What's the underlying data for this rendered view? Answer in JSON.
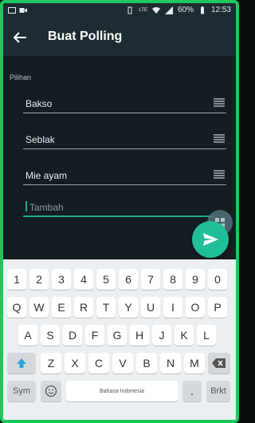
{
  "status": {
    "battery": "60%",
    "time": "12:53",
    "network": "LTE"
  },
  "appbar": {
    "title": "Buat Polling"
  },
  "section": {
    "label": "Pilihan"
  },
  "options": [
    {
      "label": "Bakso"
    },
    {
      "label": "Seblak"
    },
    {
      "label": "Mie ayam"
    }
  ],
  "add_field": {
    "placeholder": "Tambah"
  },
  "keyboard": {
    "numbers": [
      "1",
      "2",
      "3",
      "4",
      "5",
      "6",
      "7",
      "8",
      "9",
      "0"
    ],
    "row1": [
      "Q",
      "W",
      "E",
      "R",
      "T",
      "Y",
      "U",
      "I",
      "O",
      "P"
    ],
    "row2": [
      "A",
      "S",
      "D",
      "F",
      "G",
      "H",
      "J",
      "K",
      "L"
    ],
    "row3": [
      "Z",
      "X",
      "C",
      "V",
      "B",
      "N",
      "M"
    ],
    "sym": "Sym",
    "space": "Bahasa Indonesia",
    "period": ".",
    "enter": "Brkt"
  },
  "icons": {
    "back": "arrow-left-icon",
    "drag": "drag-handle-icon",
    "send": "send-icon",
    "shift": "shift-icon",
    "backspace": "backspace-icon",
    "emoji": "emoji-icon"
  },
  "colors": {
    "accent": "#1fbf98",
    "frame": "#21c55d",
    "appbar": "#1e2b33"
  }
}
